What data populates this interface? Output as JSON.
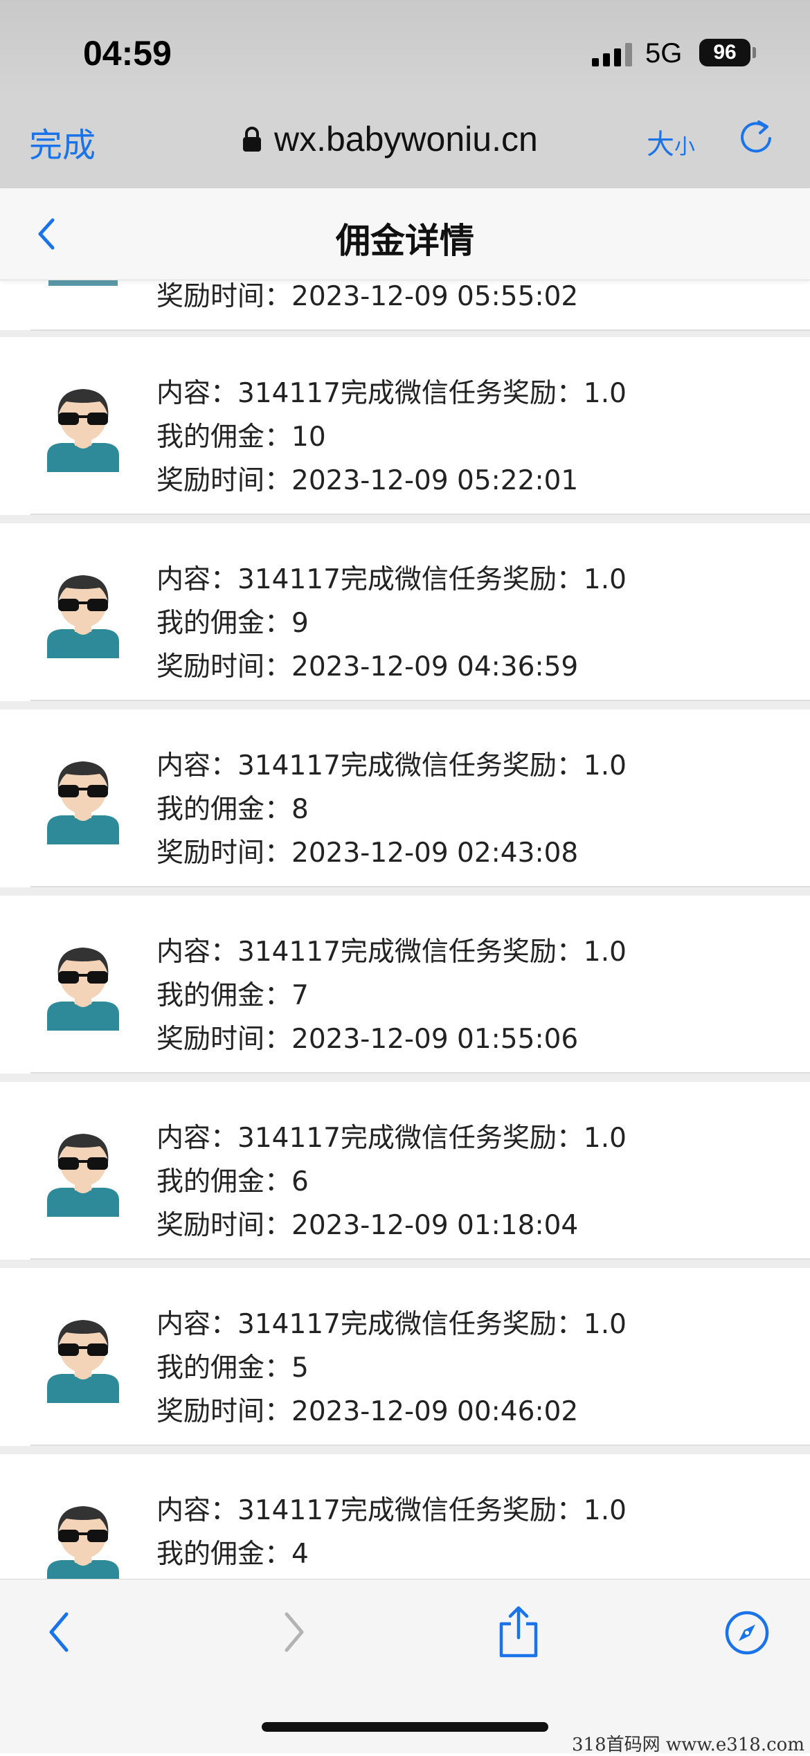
{
  "status_bar": {
    "time": "04:59",
    "network": "5G",
    "battery": "96"
  },
  "browser": {
    "done_label": "完成",
    "url": "wx.babywoniu.cn",
    "size_label_big": "大",
    "size_label_small": "小"
  },
  "nav": {
    "title": "佣金详情"
  },
  "partial_row": {
    "time_line": "奖励时间：2023-12-09 05:55:02"
  },
  "items": [
    {
      "content": "内容：314117完成微信任务奖励：1.0",
      "commission": "我的佣金：10",
      "time": "奖励时间：2023-12-09 05:22:01"
    },
    {
      "content": "内容：314117完成微信任务奖励：1.0",
      "commission": "我的佣金：9",
      "time": "奖励时间：2023-12-09 04:36:59"
    },
    {
      "content": "内容：314117完成微信任务奖励：1.0",
      "commission": "我的佣金：8",
      "time": "奖励时间：2023-12-09 02:43:08"
    },
    {
      "content": "内容：314117完成微信任务奖励：1.0",
      "commission": "我的佣金：7",
      "time": "奖励时间：2023-12-09 01:55:06"
    },
    {
      "content": "内容：314117完成微信任务奖励：1.0",
      "commission": "我的佣金：6",
      "time": "奖励时间：2023-12-09 01:18:04"
    },
    {
      "content": "内容：314117完成微信任务奖励：1.0",
      "commission": "我的佣金：5",
      "time": "奖励时间：2023-12-09 00:46:02"
    },
    {
      "content": "内容：314117完成微信任务奖励：1.0",
      "commission": "我的佣金：4",
      "time": ""
    }
  ],
  "toolbar": {
    "icons": [
      "back-icon",
      "forward-icon",
      "share-icon",
      "compass-icon"
    ]
  },
  "watermark": "318首码网  www.e318.com",
  "colors": {
    "accent": "#1a73e8",
    "avatar_shirt": "#2e8a99",
    "background": "#ededed"
  }
}
